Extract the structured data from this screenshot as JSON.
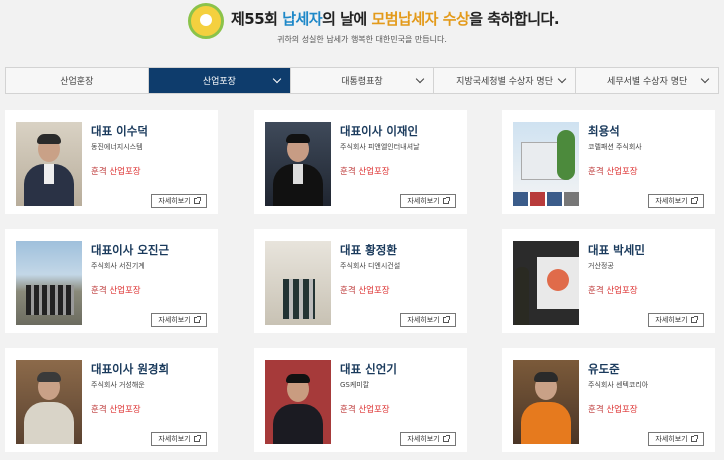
{
  "header": {
    "title_part1": "제55회 ",
    "title_part2": "납세자",
    "title_part3": "의 날에 ",
    "title_part4": "모범납세자 수상",
    "title_part5": "을 축하합니다.",
    "subtitle": "귀하의 성실한 납세가 행복한 대한민국을 만듭니다."
  },
  "tabs": [
    {
      "label": "산업훈장",
      "active": false
    },
    {
      "label": "산업포장",
      "active": true
    },
    {
      "label": "대통령표창",
      "active": false
    },
    {
      "label": "지방국세청별 수상자 명단",
      "active": false
    },
    {
      "label": "세무서별 수상자 명단",
      "active": false
    }
  ],
  "cards": [
    {
      "name": "대표 이수덕",
      "company": "동진에너지시스템",
      "grade": "훈격",
      "award": "산업포장",
      "button": "자세히보기"
    },
    {
      "name": "대표이사 이재인",
      "company": "주식회사 피앤엘인터내셔날",
      "grade": "훈격",
      "award": "산업포장",
      "button": "자세히보기"
    },
    {
      "name": "최용석",
      "company": "코렐패션 주식회사",
      "grade": "훈격",
      "award": "산업포장",
      "button": "자세히보기"
    },
    {
      "name": "대표이사 오진근",
      "company": "주식회사 서진기계",
      "grade": "훈격",
      "award": "산업포장",
      "button": "자세히보기"
    },
    {
      "name": "대표 황정환",
      "company": "주식회사 디엔시건설",
      "grade": "훈격",
      "award": "산업포장",
      "button": "자세히보기"
    },
    {
      "name": "대표 박세민",
      "company": "거산정공",
      "grade": "훈격",
      "award": "산업포장",
      "button": "자세히보기"
    },
    {
      "name": "대표이사 원경희",
      "company": "주식회사 거성해운",
      "grade": "훈격",
      "award": "산업포장",
      "button": "자세히보기"
    },
    {
      "name": "대표 신언기",
      "company": "GS케미칼",
      "grade": "훈격",
      "award": "산업포장",
      "button": "자세히보기"
    },
    {
      "name": "유도준",
      "company": "주식회사 센텍코리아",
      "grade": "훈격",
      "award": "산업포장",
      "button": "자세히보기"
    }
  ],
  "colors": {
    "active_tab": "#0e3c6c",
    "title_blue": "#1e88c8",
    "title_orange": "#e39a1a",
    "award_red": "#d33"
  }
}
